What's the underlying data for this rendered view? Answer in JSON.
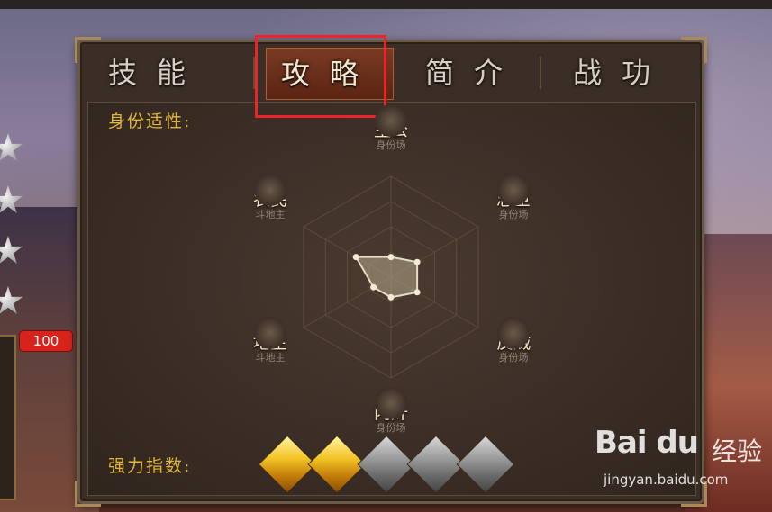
{
  "tabs": [
    {
      "label": "技能",
      "active": false
    },
    {
      "label": "攻略",
      "active": true
    },
    {
      "label": "简介",
      "active": false
    },
    {
      "label": "战功",
      "active": false
    }
  ],
  "identity_label": "身份适性:",
  "roles": {
    "lord": {
      "name": "主公",
      "sub": "身份场"
    },
    "loyalist": {
      "name": "忠臣",
      "sub": "身份场"
    },
    "rebel": {
      "name": "反贼",
      "sub": "身份场"
    },
    "traitor": {
      "name": "内奸",
      "sub": "身份场"
    },
    "landlord": {
      "name": "地主",
      "sub": "斗地主"
    },
    "farmer": {
      "name": "农民",
      "sub": "斗地主"
    }
  },
  "radar_values": {
    "lord": 0.2,
    "loyalist": 0.3,
    "rebel": 0.3,
    "traitor": 0.2,
    "landlord": 0.2,
    "farmer": 0.4
  },
  "power_label": "强力指数:",
  "power_rating": {
    "filled": 2,
    "total": 5
  },
  "badge_value": "100",
  "watermark": {
    "logo": "Bai du",
    "jingyan": "经验",
    "url": "jingyan.baidu.com"
  },
  "colors": {
    "accent_gold": "#e0b63a",
    "active_tab": "#6a2c18",
    "highlight_box": "#e8252b"
  }
}
